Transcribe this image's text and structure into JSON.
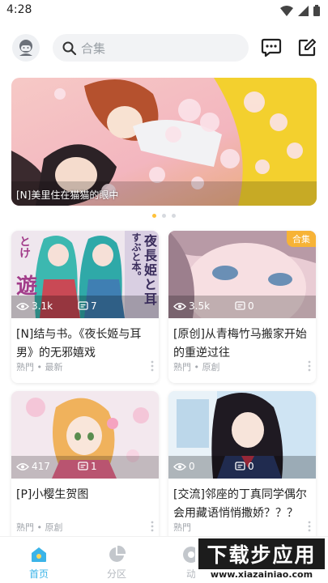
{
  "status": {
    "time": "4:28"
  },
  "header": {
    "search_placeholder": "合集"
  },
  "banner": {
    "caption": "[N]美里住在猫猫的眼中",
    "dots_count": 3,
    "active_dot": 0
  },
  "cards": [
    {
      "views": "3.1k",
      "comments": "7",
      "title": "[N]结与书。《夜长姬与耳男》的无邪嬉戏",
      "meta": "熟門 • 最新",
      "badge": "",
      "cover_text": [
        "すぶと本。",
        "夜長姫と耳",
        "とけ",
        "遊"
      ]
    },
    {
      "views": "3.5k",
      "comments": "0",
      "title": "[原创]从青梅竹马搬家开始的重逆过往",
      "meta": "熟門 • 原創",
      "badge": "合集",
      "cover_text": []
    },
    {
      "views": "417",
      "comments": "1",
      "title": "[P]小樱生贺图",
      "meta": "熟門 • 原創",
      "badge": "",
      "cover_text": []
    },
    {
      "views": "0",
      "comments": "0",
      "title": "[交流]邻座的丁真同学偶尔会用藏语悄悄撒娇？？？",
      "meta": "熟門",
      "badge": "",
      "cover_text": []
    }
  ],
  "tabs": [
    {
      "label": "首页",
      "active": true
    },
    {
      "label": "分区",
      "active": false
    },
    {
      "label": "动",
      "active": false
    }
  ],
  "watermark": {
    "title": "下载步应用",
    "url": "www.xiazainiao.com"
  },
  "colors": {
    "accent": "#3bb4e8",
    "badge": "#f7b336",
    "dot_active": "#ffc23a"
  }
}
